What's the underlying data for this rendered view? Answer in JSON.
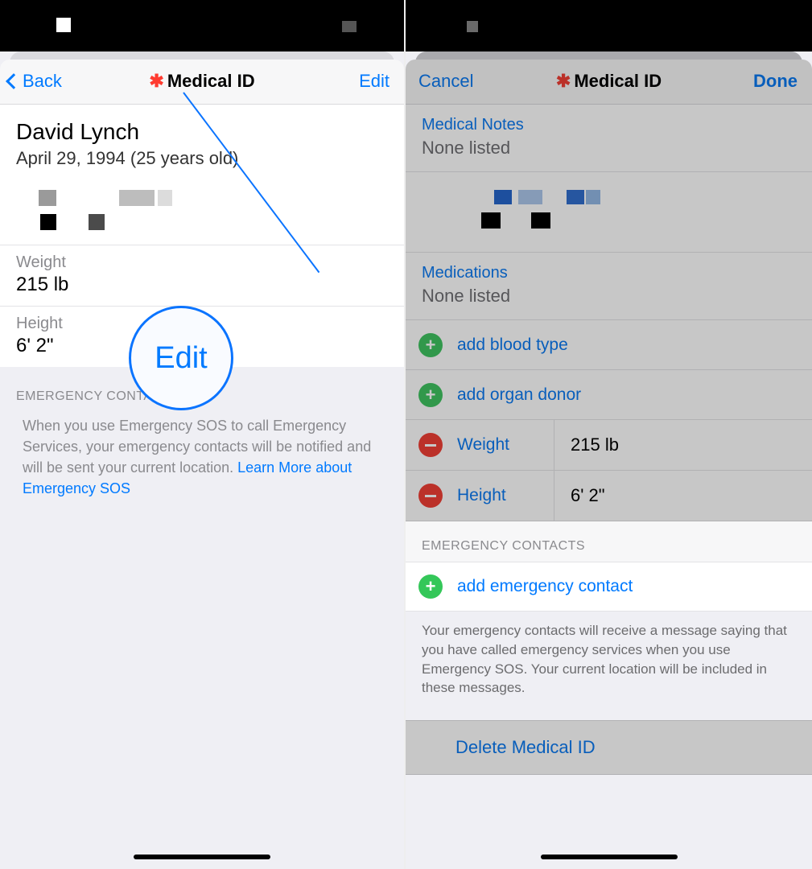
{
  "left": {
    "nav": {
      "back": "Back",
      "title": "Medical ID",
      "edit": "Edit"
    },
    "person": {
      "name": "David Lynch",
      "dob": "April 29, 1994 (25 years old)"
    },
    "weight": {
      "label": "Weight",
      "value": "215 lb"
    },
    "height": {
      "label": "Height",
      "value": "6' 2\""
    },
    "contactsHeader": "EMERGENCY CONTACTS",
    "sosText": "When you use Emergency SOS to call Emergency Services, your emergency contacts will be notified and will be sent your current location. ",
    "sosLink": "Learn More about Emergency SOS",
    "magnifier": "Edit"
  },
  "right": {
    "nav": {
      "cancel": "Cancel",
      "title": "Medical ID",
      "done": "Done"
    },
    "notes": {
      "label": "Medical Notes",
      "value": "None listed"
    },
    "meds": {
      "label": "Medications",
      "value": "None listed"
    },
    "addBlood": "add blood type",
    "addOrgan": "add organ donor",
    "weight": {
      "label": "Weight",
      "value": "215 lb"
    },
    "height": {
      "label": "Height",
      "value": "6' 2\""
    },
    "contactsHeader": "EMERGENCY CONTACTS",
    "addContact": "add emergency contact",
    "footer": "Your emergency contacts will receive a message saying that you have called emergency services when you use Emergency SOS. Your current location will be included in these messages.",
    "delete": "Delete Medical ID"
  }
}
